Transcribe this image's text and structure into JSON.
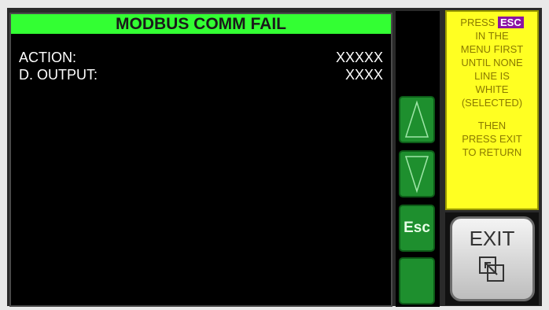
{
  "title": "MODBUS COMM FAIL",
  "rows": [
    {
      "label": "ACTION:",
      "value": "XXXXX"
    },
    {
      "label": "D. OUTPUT:",
      "value": "XXXX"
    }
  ],
  "nav": {
    "up_icon": "up-triangle-icon",
    "down_icon": "down-triangle-icon",
    "esc_label": "Esc",
    "blank_label": ""
  },
  "help": {
    "line1": "PRESS",
    "esc_badge": "ESC",
    "line2": "IN THE",
    "line3": "MENU FIRST",
    "line4": "UNTIL NONE",
    "line5": "LINE IS",
    "line6": "WHITE",
    "line7": "(SELECTED)",
    "line8": "THEN",
    "line9": "PRESS EXIT",
    "line10": "TO RETURN"
  },
  "exit": {
    "label": "EXIT",
    "icon": "window-return-icon"
  },
  "colors": {
    "title_bg": "#33ff33",
    "help_bg": "#ffff22",
    "nav_button": "#1e8f2e",
    "esc_badge": "#8b12a3"
  }
}
